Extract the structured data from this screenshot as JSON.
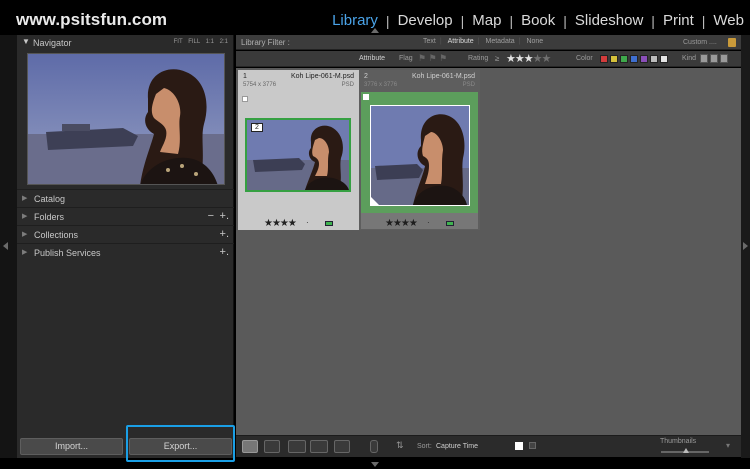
{
  "app": {
    "brand": "www.psitsfun.com"
  },
  "modules": [
    {
      "label": "Library",
      "active": true
    },
    {
      "label": "Develop",
      "active": false
    },
    {
      "label": "Map",
      "active": false
    },
    {
      "label": "Book",
      "active": false
    },
    {
      "label": "Slideshow",
      "active": false
    },
    {
      "label": "Print",
      "active": false
    },
    {
      "label": "Web",
      "active": false
    }
  ],
  "module_separator": "|",
  "left_panel": {
    "navigator": {
      "title": "Navigator",
      "zoom_options": "FIT FILL 1:1 2:1"
    },
    "sections": [
      {
        "label": "Catalog"
      },
      {
        "label": "Folders",
        "minus": "−",
        "plus": "+."
      },
      {
        "label": "Collections",
        "plus": "+."
      },
      {
        "label": "Publish Services",
        "plus": "+."
      }
    ],
    "import_label": "Import...",
    "export_label": "Export..."
  },
  "filter_bar": {
    "title": "Library Filter :",
    "tabs": [
      "Text",
      "Attribute",
      "Metadata",
      "None"
    ],
    "active_tab": "Attribute",
    "preset": "Custom ...."
  },
  "attribute_bar": {
    "attribute": "Attribute",
    "flag": "Flag",
    "rating_label": "Rating",
    "rating_op": "≥",
    "rating_stars": "★★★",
    "rating_empty": "★★",
    "color_label": "Color",
    "kind_label": "Kind",
    "swatch_colors": [
      "#d23c3c",
      "#d6c13b",
      "#3fa94c",
      "#3f6fcf",
      "#8a4fb8",
      "#bcbcbc",
      "#e4e4e4"
    ]
  },
  "grid": {
    "cells": [
      {
        "index": "1",
        "filename": "Koh Lipe-061-M.psd",
        "dimensions": "5754 x 3776",
        "ext": "PSD",
        "rating": "★★★★",
        "dot": "·",
        "stack_count": "2",
        "label_color": "#3fb34f",
        "selected": false
      },
      {
        "index": "2",
        "filename": "Koh Lipe-061-M.psd",
        "dimensions": "3776 x 3776",
        "ext": "PSD",
        "rating": "★★★★",
        "dot": "·",
        "label_color": "#3fb34f",
        "selected": true
      }
    ]
  },
  "toolbar": {
    "sort_label": "Sort:",
    "sort_value": "Capture Time",
    "thumbnails_label": "Thumbnails"
  },
  "colors": {
    "accent_blue": "#4aa3e8",
    "highlight_blue": "#1a9fe6",
    "label_green": "#3fb34f",
    "selection_green": "#5c9e5c"
  }
}
